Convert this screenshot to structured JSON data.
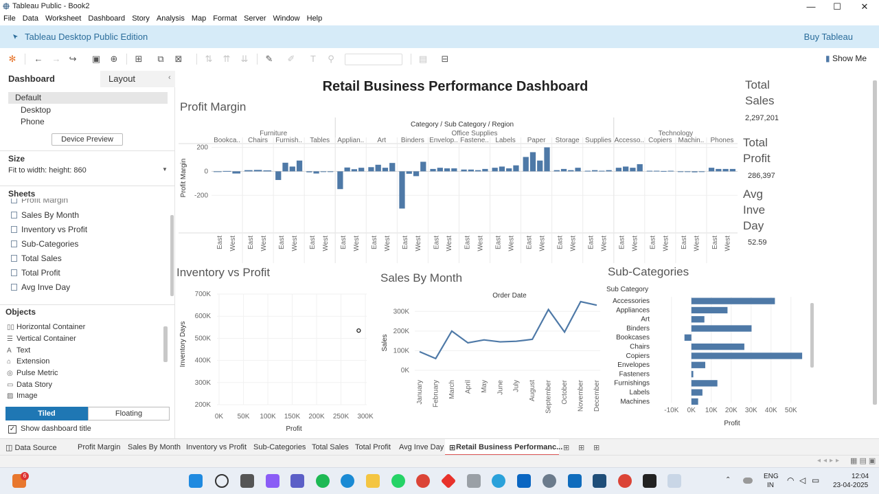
{
  "window": {
    "title": "Tableau Public - Book2",
    "minimize": "—",
    "maximize": "☐",
    "close": "✕"
  },
  "menu": [
    "File",
    "Data",
    "Worksheet",
    "Dashboard",
    "Story",
    "Analysis",
    "Map",
    "Format",
    "Server",
    "Window",
    "Help"
  ],
  "banner": {
    "label": "Tableau Desktop Public Edition",
    "buy": "Buy Tableau"
  },
  "toolbar": {
    "show_me": "Show Me"
  },
  "left_pane": {
    "tabs": {
      "dashboard": "Dashboard",
      "layout": "Layout"
    },
    "device": {
      "items": [
        "Default",
        "Desktop",
        "Phone"
      ],
      "preview_button": "Device Preview"
    },
    "size": {
      "heading": "Size",
      "value": "Fit to width: height: 860"
    },
    "sheets": {
      "heading": "Sheets",
      "partial": "Profit Margin",
      "items": [
        "Sales By Month",
        "Inventory vs Profit",
        "Sub-Categories",
        "Total Sales",
        "Total Profit",
        "Avg Inve Day"
      ]
    },
    "objects": {
      "heading": "Objects",
      "items": [
        "Horizontal Container",
        "Vertical Container",
        "Text",
        "Extension",
        "Pulse Metric",
        "Data Story",
        "Image"
      ]
    },
    "mode": {
      "tiled": "Tiled",
      "floating": "Floating"
    },
    "show_title": "Show dashboard title"
  },
  "dashboard": {
    "title": "Retail Business Performance Dashboard",
    "kpis": [
      {
        "title_lines": [
          "Total",
          "Sales"
        ],
        "value": "2,297,201"
      },
      {
        "title_lines": [
          "Total",
          "Profit"
        ],
        "value": "286,397"
      },
      {
        "title_lines": [
          "Avg",
          "Inve",
          "Day"
        ],
        "value": "52.59"
      }
    ],
    "profit_margin": {
      "title": "Profit Margin"
    },
    "inventory_vs_profit": {
      "title": "Inventory vs Profit"
    },
    "sales_by_month": {
      "title": "Sales By Month"
    },
    "sub_categories": {
      "title": "Sub-Categories"
    }
  },
  "chart_data": [
    {
      "type": "bar",
      "title": "Profit Margin",
      "header": "Category / Sub Category / Region",
      "ylabel": "Profit Margin",
      "ylim": [
        -330,
        220
      ],
      "yticks": [
        200,
        0,
        -200
      ],
      "color": "#4e79a7",
      "regions": [
        "East",
        "West"
      ],
      "categories": [
        {
          "name": "Furniture",
          "subcats": [
            {
              "label": "Bookca..",
              "values": [
                -3,
                3,
                -18
              ]
            },
            {
              "label": "Chairs",
              "values": [
                10,
                12,
                8
              ]
            },
            {
              "label": "Furnish..",
              "values": [
                -72,
                72,
                40,
                90
              ]
            },
            {
              "label": "Tables",
              "values": [
                -8,
                -18,
                -5,
                -5
              ]
            }
          ]
        },
        {
          "name": "Office Supplies",
          "subcats": [
            {
              "label": "Applian..",
              "values": [
                -148,
                32,
                18,
                30
              ]
            },
            {
              "label": "Art",
              "values": [
                35,
                55,
                30,
                70
              ]
            },
            {
              "label": "Binders",
              "values": [
                -310,
                -20,
                -40,
                80
              ]
            },
            {
              "label": "Envelop..",
              "values": [
                20,
                30,
                25,
                25
              ]
            },
            {
              "label": "Fastene..",
              "values": [
                15,
                15,
                10,
                20
              ]
            },
            {
              "label": "Labels",
              "values": [
                30,
                40,
                25,
                50
              ]
            },
            {
              "label": "Paper",
              "values": [
                120,
                160,
                90,
                200
              ]
            },
            {
              "label": "Storage",
              "values": [
                10,
                20,
                10,
                30
              ]
            },
            {
              "label": "Supplies",
              "values": [
                5,
                10,
                5,
                10
              ]
            }
          ]
        },
        {
          "name": "Technology",
          "subcats": [
            {
              "label": "Accesso..",
              "values": [
                30,
                40,
                30,
                60
              ]
            },
            {
              "label": "Copiers",
              "values": [
                5,
                5,
                3,
                5
              ]
            },
            {
              "label": "Machin..",
              "values": [
                -5,
                -5,
                -8,
                -5
              ]
            },
            {
              "label": "Phones",
              "values": [
                30,
                20,
                20,
                20
              ]
            }
          ]
        }
      ]
    },
    {
      "type": "scatter",
      "title": "Inventory vs Profit",
      "xlabel": "Profit",
      "ylabel": "Inventory Days",
      "xticks": [
        "0K",
        "50K",
        "100K",
        "150K",
        "200K",
        "250K",
        "300K"
      ],
      "yticks": [
        "700K",
        "600K",
        "500K",
        "400K",
        "300K",
        "200K"
      ],
      "xlim": [
        0,
        300000
      ],
      "ylim": [
        200000,
        700000
      ],
      "points": [
        {
          "x": 286397,
          "y": 535000
        }
      ]
    },
    {
      "type": "line",
      "title": "Sales By Month",
      "header": "Order Date",
      "ylabel": "Sales",
      "ylim": [
        0,
        350000
      ],
      "yticks": [
        "300K",
        "200K",
        "100K",
        "0K"
      ],
      "color": "#4e79a7",
      "x": [
        "January",
        "February",
        "March",
        "April",
        "May",
        "June",
        "July",
        "August",
        "September",
        "October",
        "November",
        "December"
      ],
      "values": [
        95000,
        60000,
        200000,
        140000,
        155000,
        145000,
        148000,
        158000,
        310000,
        195000,
        350000,
        332000
      ]
    },
    {
      "type": "bar",
      "orientation": "horizontal",
      "title": "Sub-Categories",
      "header": "Sub Category",
      "xlabel": "Profit",
      "xticks": [
        "-10K",
        "0K",
        "10K",
        "20K",
        "30K",
        "40K",
        "50K"
      ],
      "xlim": [
        -12000,
        58000
      ],
      "color": "#4e79a7",
      "categories": [
        "Accessories",
        "Appliances",
        "Art",
        "Binders",
        "Bookcases",
        "Chairs",
        "Copiers",
        "Envelopes",
        "Fasteners",
        "Furnishings",
        "Labels",
        "Machines"
      ],
      "values": [
        41937,
        18138,
        6528,
        30222,
        -3473,
        26590,
        55618,
        6964,
        950,
        13059,
        5546,
        3385
      ]
    }
  ],
  "sheet_tabs": {
    "data_source": "Data Source",
    "items": [
      "Profit Margin",
      "Sales By Month",
      "Inventory vs Profit",
      "Sub-Categories",
      "Total Sales",
      "Total Profit",
      "Avg Inve Day",
      "Retail Business Performanc..."
    ],
    "active": 7
  },
  "taskbar": {
    "lang1": "ENG",
    "lang2": "IN",
    "time": "12:04",
    "date": "23-04-2025",
    "badge": "6"
  }
}
